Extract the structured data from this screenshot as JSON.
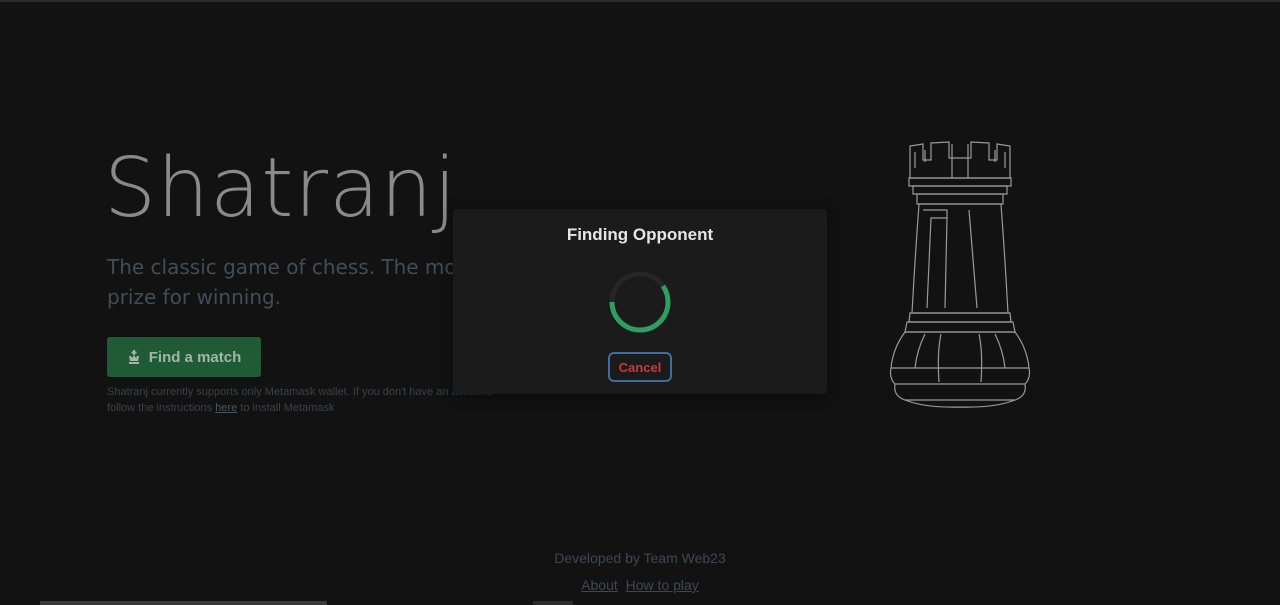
{
  "hero": {
    "title": "Shatranj",
    "subtitle": "The classic game of chess. The mode",
    "subtitle_line2": "prize for winning.",
    "find_button_label": "Find a match",
    "note_prefix": "Shatranj currently supports only Metamask wallet. If you don't have an account,",
    "note_line2_prefix": "follow the instructions ",
    "note_link": "here",
    "note_suffix": " to install Metamask"
  },
  "modal": {
    "title": "Finding Opponent",
    "cancel_label": "Cancel"
  },
  "footer": {
    "credit": "Developed by Team Web23",
    "links": [
      "About",
      "How to play"
    ]
  },
  "icons": {
    "find_button": "chess-king-icon",
    "spinner": "loading-spinner-icon",
    "illustration": "chess-rook-icon"
  },
  "colors": {
    "background": "#121212",
    "accent_green": "#1f5c35",
    "spinner_green": "#2f9e61",
    "cancel_red": "#c93a3a",
    "cancel_border": "#3a6fa0"
  }
}
